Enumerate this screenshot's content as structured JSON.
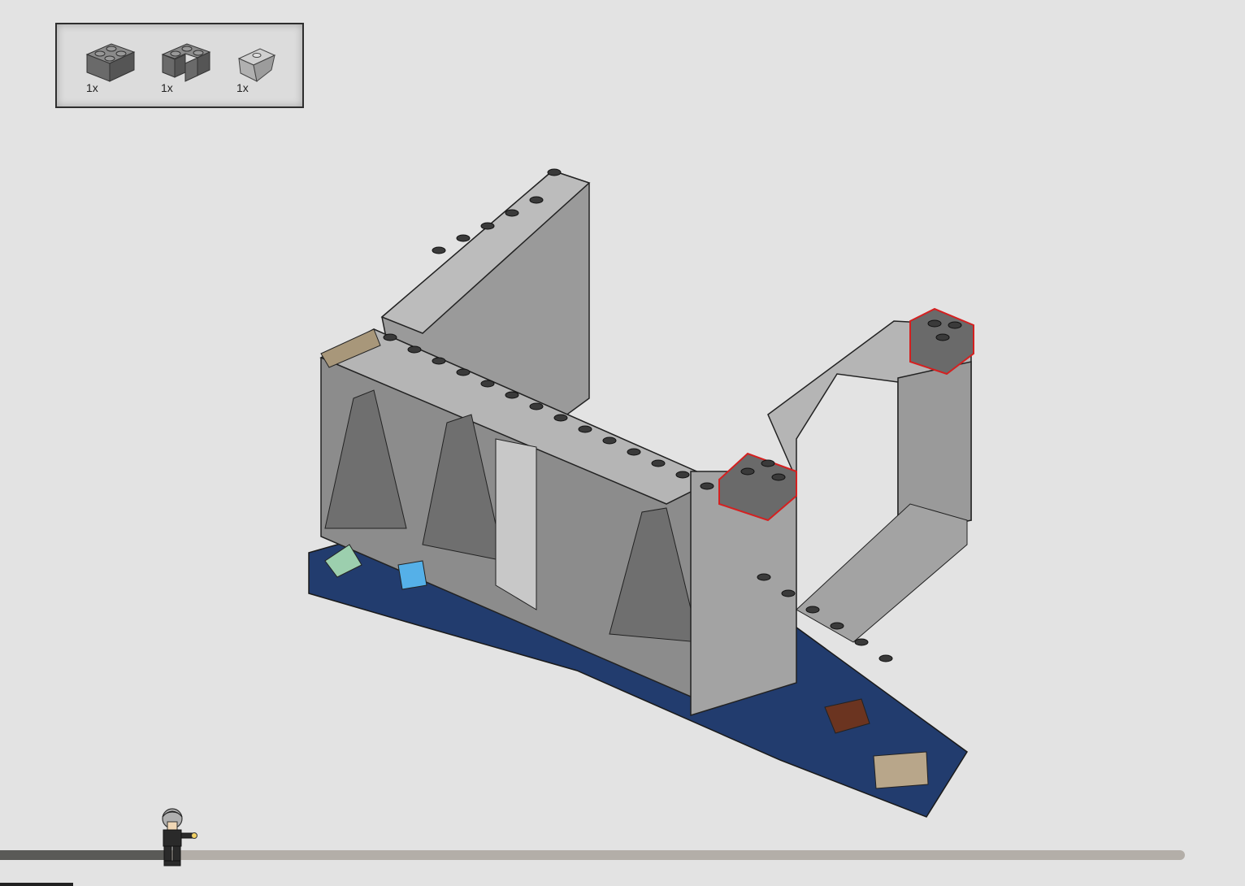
{
  "parts_panel": {
    "items": [
      {
        "name": "dark-gray-brick-2x2-icon",
        "quantity": "1x",
        "color": "#7a7a7a"
      },
      {
        "name": "dark-gray-corner-brick-icon",
        "quantity": "1x",
        "color": "#7a7a7a"
      },
      {
        "name": "light-gray-inverted-slope-icon",
        "quantity": "1x",
        "color": "#b9b9b9"
      }
    ]
  },
  "progress": {
    "fraction": 0.14,
    "fill_color": "#5a5a57",
    "track_color": "#b3aea8"
  },
  "colors": {
    "background": "#e3e3e3",
    "highlight": "#d42020",
    "base_blue": "#223c6e",
    "dark_gray": "#6c6c6c",
    "light_gray": "#a8a8a8"
  }
}
